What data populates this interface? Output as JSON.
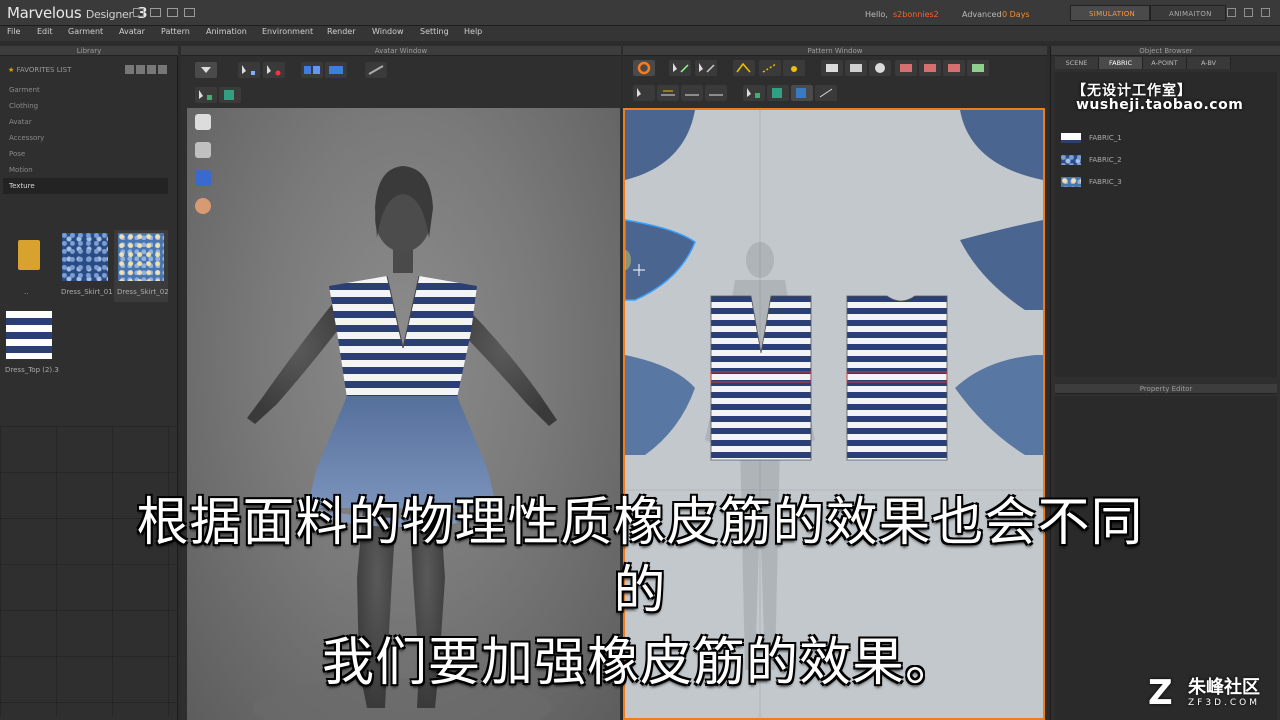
{
  "app": {
    "name": "Marvelous",
    "name_sub": "Designer",
    "version": "3",
    "hello_label": "Hello,",
    "user": "s2bonnies2",
    "advanced_label": "Advanced",
    "days": "0 Days",
    "mode_simulation": "SIMULATION",
    "mode_animation": "ANIMAITON"
  },
  "menu": [
    "File",
    "Edit",
    "Garment",
    "Avatar",
    "Pattern",
    "Animation",
    "Environment",
    "Render",
    "Window",
    "Setting",
    "Help"
  ],
  "panels": {
    "library": "Library",
    "avatar_window": "Avatar Window",
    "pattern_window": "Pattern Window",
    "object_browser": "Object Browser",
    "property_editor": "Property Editor"
  },
  "library": {
    "favorites": "FAVORITES LIST",
    "items": [
      "Garment",
      "Clothing",
      "Avatar",
      "Accessory",
      "Pose",
      "Motion",
      "Texture"
    ],
    "selected_index": 6,
    "thumbs": [
      {
        "caption": ".."
      },
      {
        "caption": "Dress_Skirt_01"
      },
      {
        "caption": "Dress_Skirt_02"
      },
      {
        "caption": "Dress_Top (2).3"
      }
    ]
  },
  "object_browser": {
    "tabs": [
      "SCENE",
      "FABRIC",
      "A-POINT",
      "A-BV"
    ],
    "active_tab": 1,
    "fabrics": [
      "FABRIC_1",
      "FABRIC_2",
      "FABRIC_3"
    ]
  },
  "watermark": {
    "line1": "【无设计工作室】",
    "line2": "wusheji.taobao.com"
  },
  "subtitles": {
    "line1": "根据面料的物理性质橡皮筋的效果也会不同",
    "line2": "的",
    "line3": "我们要加强橡皮筋的效果。"
  },
  "site": {
    "cn": "朱峰社区",
    "en": "ZF3D.COM"
  },
  "colors": {
    "accent": "#f07d1a",
    "highlight_user": "#ff5f2a",
    "pattern_blue": "#4a6590",
    "stripe_navy": "#2c3f74"
  }
}
